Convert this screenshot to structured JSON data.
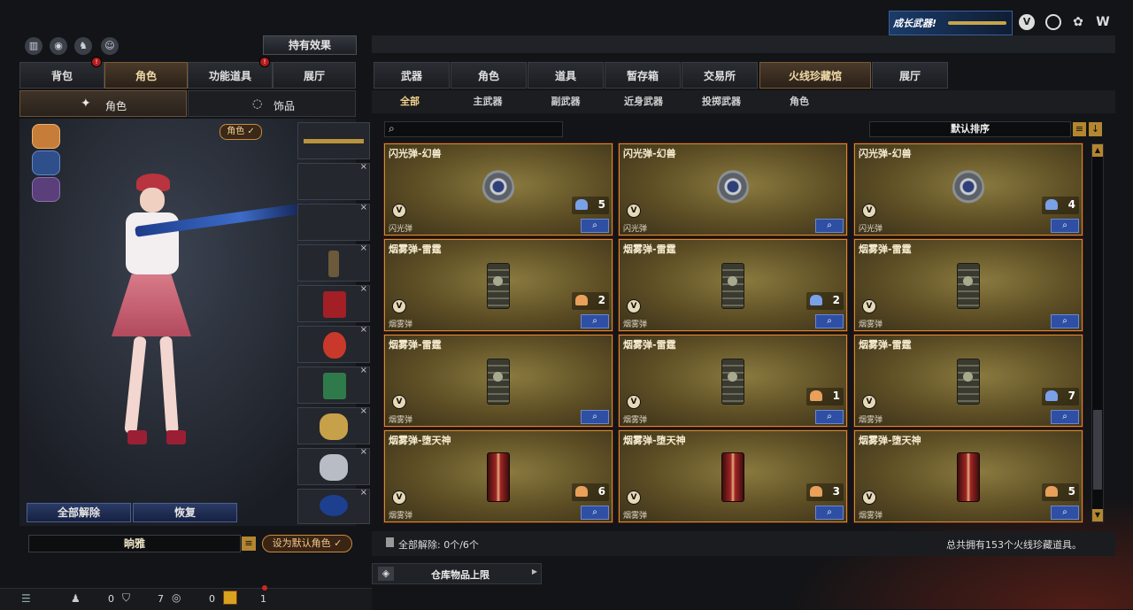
{
  "header": {
    "promo_text": "成长武器!",
    "icons": [
      "shield-v-icon",
      "target-icon",
      "gift-rose-icon",
      "w-logo-icon"
    ]
  },
  "left": {
    "top_icons": [
      "stats-icon",
      "eye-orbit-icon",
      "person-run-icon",
      "pet-icon"
    ],
    "effects_button": "持有效果",
    "tabs": [
      {
        "label": "背包",
        "badge": true,
        "active": false
      },
      {
        "label": "角色",
        "badge": false,
        "active": true
      },
      {
        "label": "功能道具",
        "badge": true,
        "active": false
      },
      {
        "label": "展厅",
        "badge": false,
        "active": false
      }
    ],
    "subtabs": [
      {
        "label": "角色",
        "active": true
      },
      {
        "label": "饰品",
        "active": false
      }
    ],
    "role_tag": "角色",
    "slot_count": 10,
    "buttons": {
      "unequip_all": "全部解除",
      "restore": "恢复"
    },
    "char_name": "晌雅",
    "set_default": "设为默认角色"
  },
  "right": {
    "main_tabs": [
      {
        "label": "武器",
        "active": false
      },
      {
        "label": "角色",
        "active": false
      },
      {
        "label": "道具",
        "active": false
      },
      {
        "label": "暂存箱",
        "active": false
      },
      {
        "label": "交易所",
        "active": false
      },
      {
        "label": "火线珍藏馆",
        "active": true
      },
      {
        "label": "展厅",
        "active": false
      }
    ],
    "sub_tabs": [
      {
        "label": "全部",
        "active": true
      },
      {
        "label": "主武器",
        "active": false
      },
      {
        "label": "副武器",
        "active": false
      },
      {
        "label": "近身武器",
        "active": false
      },
      {
        "label": "投掷武器",
        "active": false
      },
      {
        "label": "角色",
        "active": false
      }
    ],
    "search_placeholder": "",
    "sort_label": "默认排序",
    "cards": [
      {
        "title": "闪光弹-幻兽",
        "type": "flash",
        "count": "5",
        "category": "闪光弹",
        "cake": "blue"
      },
      {
        "title": "闪光弹-幻兽",
        "type": "flash",
        "count": "",
        "category": "闪光弹",
        "cake": ""
      },
      {
        "title": "闪光弹-幻兽",
        "type": "flash",
        "count": "4",
        "category": "闪光弹",
        "cake": "blue"
      },
      {
        "title": "烟雾弹-雷霆",
        "type": "smoke",
        "count": "2",
        "category": "烟雾弹",
        "cake": "orange"
      },
      {
        "title": "烟雾弹-雷霆",
        "type": "smoke",
        "count": "2",
        "category": "烟雾弹",
        "cake": "blue"
      },
      {
        "title": "烟雾弹-雷霆",
        "type": "smoke",
        "count": "",
        "category": "烟雾弹",
        "cake": ""
      },
      {
        "title": "烟雾弹-雷霆",
        "type": "smoke",
        "count": "",
        "category": "烟雾弹",
        "cake": ""
      },
      {
        "title": "烟雾弹-雷霆",
        "type": "smoke",
        "count": "1",
        "category": "烟雾弹",
        "cake": "orange"
      },
      {
        "title": "烟雾弹-雷霆",
        "type": "smoke",
        "count": "7",
        "category": "烟雾弹",
        "cake": "blue"
      },
      {
        "title": "烟雾弹-堕天神",
        "type": "red",
        "count": "6",
        "category": "烟雾弹",
        "cake": "orange"
      },
      {
        "title": "烟雾弹-堕天神",
        "type": "red",
        "count": "3",
        "category": "烟雾弹",
        "cake": "orange"
      },
      {
        "title": "烟雾弹-堕天神",
        "type": "red",
        "count": "5",
        "category": "烟雾弹",
        "cake": "orange"
      }
    ],
    "footer_left": "全部解除:  0个/6个",
    "footer_right": "总共拥有153个火线珍藏道具。",
    "warehouse": "仓库物品上限"
  },
  "bottom_bar": {
    "counts": [
      "0",
      "7",
      "0",
      "1"
    ]
  },
  "colors": {
    "accent_gold": "#c9902f",
    "active_tab": "#f0d9a8",
    "zoom_blue": "#2e4fa3",
    "badge_red": "#b51c1c"
  }
}
